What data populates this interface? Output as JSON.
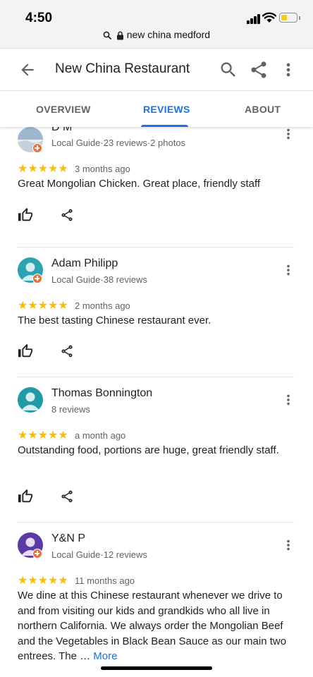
{
  "status_bar": {
    "time": "4:50",
    "url": "new china medford",
    "battery_level": 0.4,
    "icons": [
      "signal-icon",
      "wifi-icon",
      "battery-icon",
      "search-icon",
      "lock-icon"
    ]
  },
  "header": {
    "title": "New China Restaurant",
    "icons": [
      "back-arrow-icon",
      "search-icon",
      "share-icon",
      "more-vert-icon"
    ]
  },
  "tabs": [
    {
      "label": "OVERVIEW",
      "active": false
    },
    {
      "label": "REVIEWS",
      "active": true
    },
    {
      "label": "ABOUT",
      "active": false
    }
  ],
  "colors": {
    "accent": "#1a73e8",
    "star": "#fbbc04",
    "guide_badge": "#e8713c"
  },
  "reviews": [
    {
      "name": "D M",
      "meta": "Local Guide·23 reviews·2 photos",
      "rating": 5,
      "stars": "★★★★★",
      "ago": "3 months ago",
      "text": "Great Mongolian Chicken. Great place, friendly staff",
      "avatar": "photo-avatar"
    },
    {
      "name": "Adam Philipp",
      "meta": "Local Guide·38 reviews",
      "rating": 5,
      "stars": "★★★★★",
      "ago": "2 months ago",
      "text": "The best tasting Chinese restaurant ever.",
      "avatar": "default-avatar-teal"
    },
    {
      "name": "Thomas Bonnington",
      "meta": "8 reviews",
      "rating": 5,
      "stars": "★★★★★",
      "ago": "a month ago",
      "text": "Outstanding food, portions are huge, great friendly staff.",
      "avatar": "default-avatar-teal"
    },
    {
      "name": "Y&N P",
      "meta": "Local Guide·12 reviews",
      "rating": 5,
      "stars": "★★★★★",
      "ago": "11 months ago",
      "text": "We dine at this Chinese restaurant whenever we drive to and from visiting our kids and grandkids who all live in northern California.  We always order the Mongolian Beef and the Vegetables in Black Bean Sauce as our main two entrees.  The … ",
      "more_label": "More",
      "avatar": "default-avatar-purple"
    }
  ]
}
